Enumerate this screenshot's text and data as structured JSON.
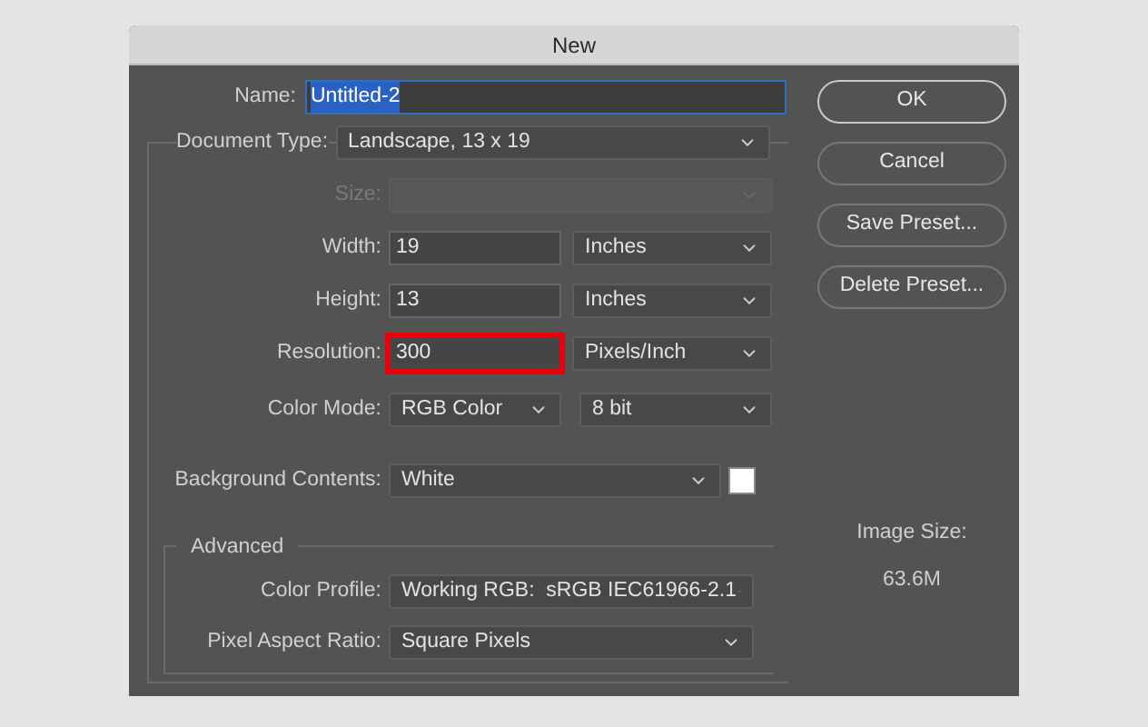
{
  "window": {
    "title": "New"
  },
  "name_field": {
    "label": "Name:",
    "value": "Untitled-2",
    "text_selected": true
  },
  "document_type": {
    "label": "Document Type:",
    "value": "Landscape, 13 x 19"
  },
  "fields": [
    {
      "kind": "select",
      "label": "Size:",
      "disabled": true
    },
    {
      "kind": "number_unit",
      "label": "Width:",
      "value": "19",
      "unit": "Inches",
      "highlighted": false
    },
    {
      "kind": "number_unit",
      "label": "Height:",
      "value": "13",
      "unit": "Inches",
      "highlighted": false
    },
    {
      "kind": "number_unit",
      "label": "Resolution:",
      "value": "300",
      "unit": "Pixels/Inch",
      "highlighted": true
    },
    {
      "kind": "two_selects",
      "label": "Color Mode:",
      "value": "RGB Color",
      "unit": "8 bit"
    },
    {
      "kind": "select_swatch",
      "label": "Background Contents:",
      "value": "White",
      "color": "#ffffff"
    }
  ],
  "advanced": {
    "title": "Advanced",
    "fields": [
      {
        "label": "Color Profile:",
        "value": "Working RGB:  sRGB IEC61966-2.1"
      },
      {
        "label": "Pixel Aspect Ratio:",
        "value": "Square Pixels"
      }
    ]
  },
  "buttons": [
    {
      "label": "OK",
      "default": true
    },
    {
      "label": "Cancel",
      "default": false
    },
    {
      "label": "Save Preset...",
      "default": false
    },
    {
      "label": "Delete Preset...",
      "default": false
    }
  ],
  "image_size": {
    "label": "Image Size:",
    "value": "63.6M"
  }
}
